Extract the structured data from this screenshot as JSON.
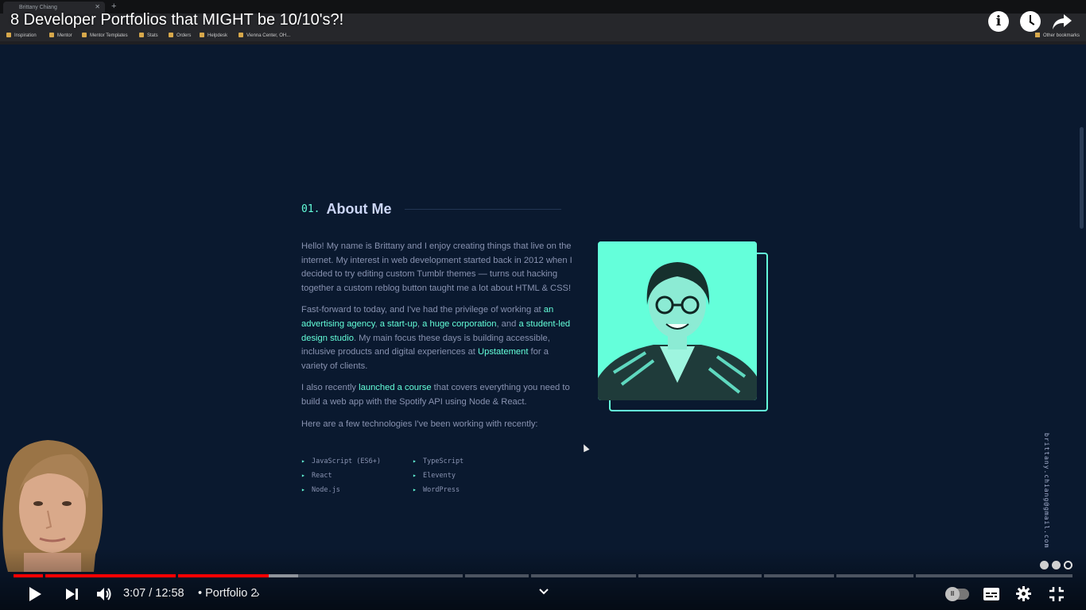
{
  "browser": {
    "tab_title": "Brittany Chiang",
    "bookmarks": [
      "Inspiration",
      "Mentor",
      "Mentor Templates",
      "Stats",
      "Orders",
      "Helpdesk",
      "Vienna Center, OH..."
    ],
    "other_bookmarks": "Other bookmarks"
  },
  "video": {
    "title": "8 Developer Portfolios that MIGHT be 10/10's?!",
    "time": "3:07 / 12:58",
    "chapter": "• Portfolio 2",
    "chapter_chevron": "›",
    "progress_fraction": 0.24,
    "accent_color": "#ff0000"
  },
  "portfolio": {
    "section_number": "01.",
    "section_title": "About Me",
    "paragraph1": "Hello! My name is Brittany and I enjoy creating things that live on the internet. My interest in web development started back in 2012 when I decided to try editing custom Tumblr themes — turns out hacking together a custom reblog button taught me a lot about HTML & CSS!",
    "p2": {
      "lead": "Fast-forward to today, and I've had the privilege of working at ",
      "link1": "an advertising agency",
      "sep1": ", ",
      "link2": "a start-up",
      "sep2": ", ",
      "link3": "a huge corporation",
      "sep3": ", and ",
      "link4": "a student-led design studio",
      "mid": ". My main focus these days is building accessible, inclusive products and digital experiences at ",
      "link5": "Upstatement",
      "tail": " for a variety of clients."
    },
    "p3": {
      "lead": "I also recently ",
      "link": "launched a course",
      "tail": " that covers everything you need to build a web app with the Spotify API using Node & React."
    },
    "paragraph4": "Here are a few technologies I've been working with recently:",
    "technologies": [
      "JavaScript (ES6+)",
      "TypeScript",
      "React",
      "Eleventy",
      "Node.js",
      "WordPress"
    ],
    "email": "brittany.chiang@gmail.com",
    "accent_color": "#64ffda",
    "background_color": "#0a192f"
  }
}
